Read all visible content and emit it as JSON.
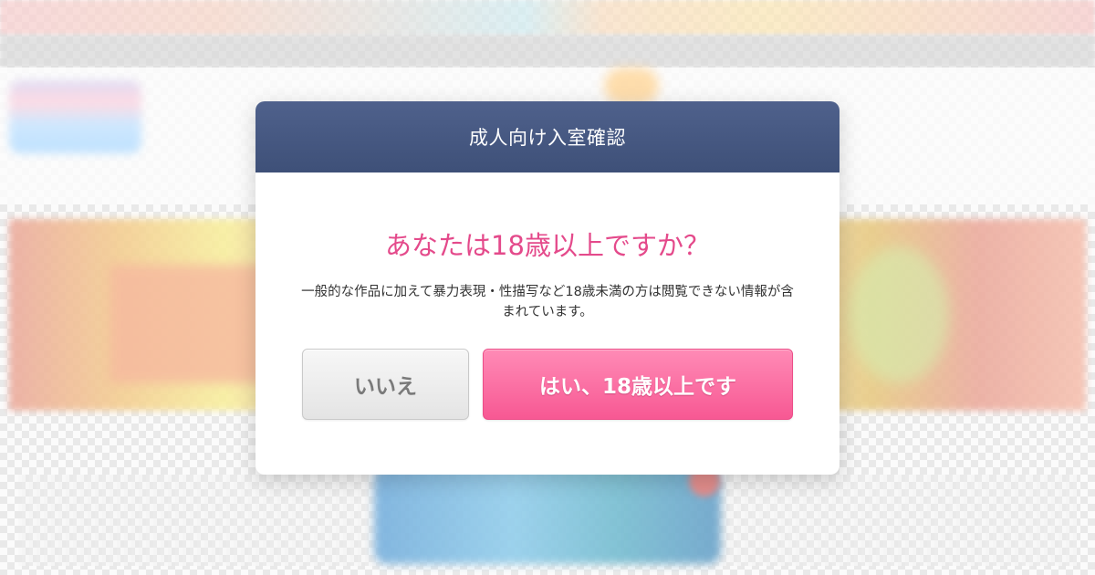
{
  "modal": {
    "title": "成人向け入室確認",
    "question": "あなたは18歳以上ですか？",
    "description": "一般的な作品に加えて暴力表現・性描写など18歳未満の方は閲覧できない情報が含まれています。",
    "buttons": {
      "no_label": "いいえ",
      "yes_label": "はい、18歳以上です"
    }
  },
  "colors": {
    "header_bg": "#46587f",
    "accent_pink": "#e44a8b",
    "yes_button": "#f75893",
    "no_button": "#e4e4e4"
  }
}
